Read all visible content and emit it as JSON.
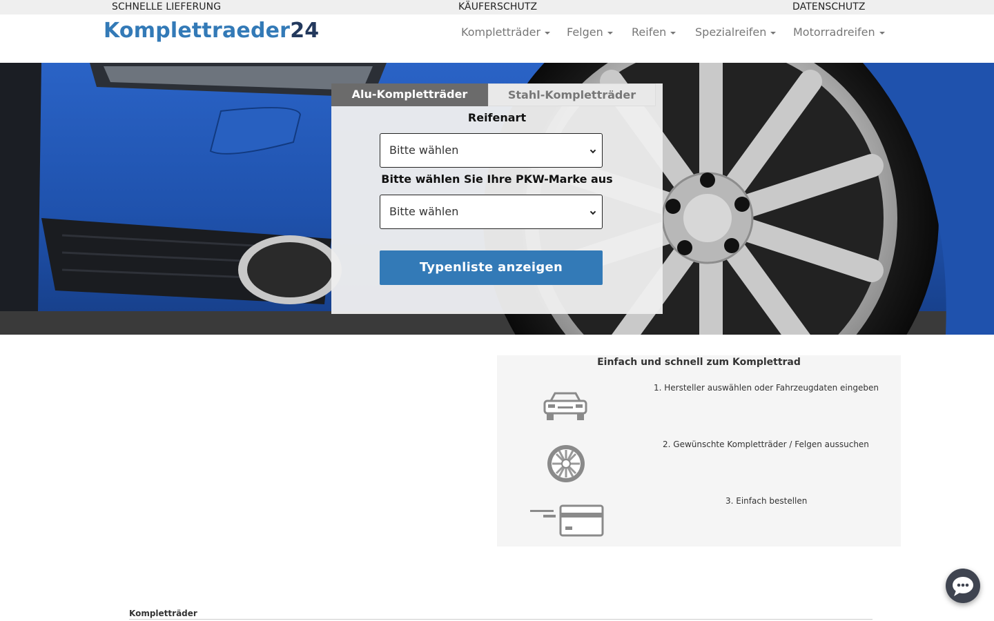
{
  "topbar": {
    "item1": "SCHNELLE LIEFERUNG",
    "item2": "KÄUFERSCHUTZ",
    "item3": "DATENSCHUTZ"
  },
  "header": {
    "logo_main": "Komplettraeder",
    "logo_num": "24",
    "nav": [
      {
        "label": "Kompletträder"
      },
      {
        "label": "Felgen"
      },
      {
        "label": "Reifen"
      },
      {
        "label": "Spezialreifen"
      },
      {
        "label": "Motorradreifen"
      }
    ]
  },
  "form": {
    "tabs": [
      {
        "label": "Alu-Kompletträder",
        "active": true
      },
      {
        "label": "Stahl-Kompletträder",
        "active": false
      }
    ],
    "reifenart_label": "Reifenart",
    "reifenart_value": "Bitte wählen",
    "marke_label": "Bitte wählen Sie Ihre PKW-Marke aus",
    "marke_value": "Bitte wählen",
    "submit_label": "Typenliste anzeigen"
  },
  "steps": {
    "title": "Einfach und schnell zum Komplettrad",
    "items": [
      {
        "text": "1. Hersteller auswählen oder Fahrzeugdaten eingeben",
        "icon": "car-icon"
      },
      {
        "text": "2. Gewünschte Kompletträder / Felgen aussuchen",
        "icon": "wheel-icon"
      },
      {
        "text": "3. Einfach bestellen",
        "icon": "credit-card-icon"
      }
    ]
  },
  "bottom": {
    "heading": "Kompletträder"
  },
  "colors": {
    "brand": "#337ab7",
    "brand_dark": "#23395d",
    "tab_active": "#6b6b6b"
  }
}
